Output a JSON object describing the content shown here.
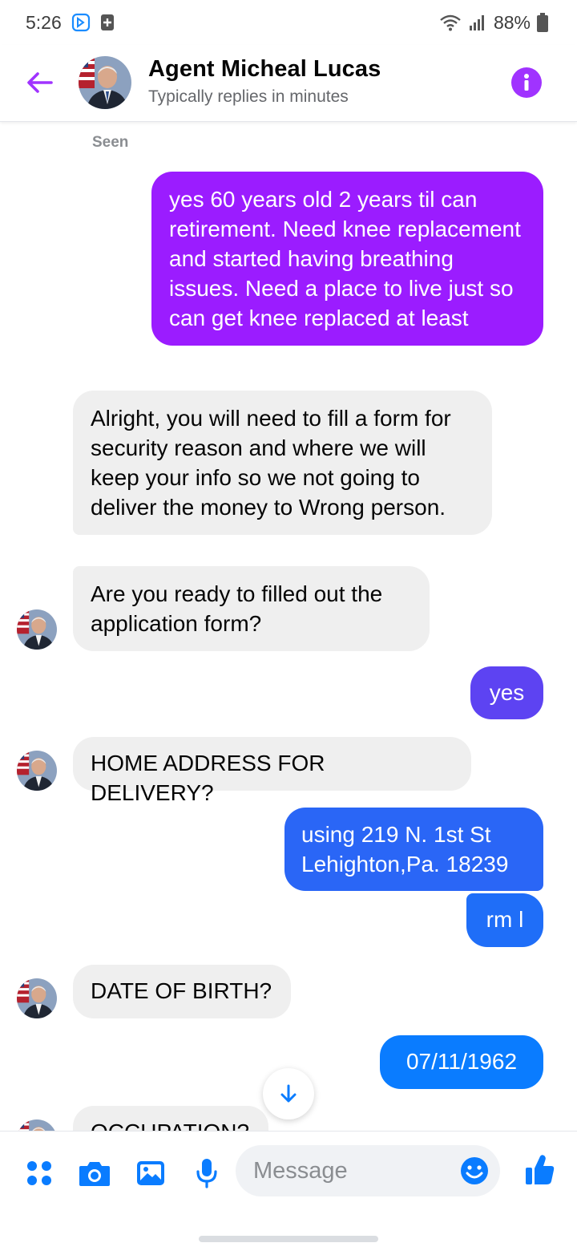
{
  "status_bar": {
    "time": "5:26",
    "battery": "88%"
  },
  "header": {
    "name": "Agent Micheal Lucas",
    "subtitle": "Typically replies in minutes"
  },
  "chat": {
    "seen_label": "Seen",
    "messages": [
      {
        "dir": "out",
        "text": "yes 60 years old 2 years til can retirement. Need knee replacement and started having breathing issues. Need a place to live just so can get knee replaced at least"
      },
      {
        "dir": "in",
        "text": "Alright, you will need to fill a form for security reason and where we will keep your info so we not going to deliver the money to Wrong person."
      },
      {
        "dir": "in",
        "text": "Are you ready to filled out the application form?"
      },
      {
        "dir": "out",
        "text": "yes"
      },
      {
        "dir": "in",
        "text": "HOME ADDRESS FOR DELIVERY?"
      },
      {
        "dir": "out",
        "text": "using 219 N. 1st St Lehighton,Pa. 18239"
      },
      {
        "dir": "out",
        "text": "rm l"
      },
      {
        "dir": "in",
        "text": "DATE OF BIRTH?"
      },
      {
        "dir": "out",
        "text": "07/11/1962"
      },
      {
        "dir": "in",
        "text": "OCCUPATION?"
      }
    ]
  },
  "composer": {
    "placeholder": "Message"
  },
  "colors": {
    "accent": "#a033ff",
    "messenger_blue": "#0a7cff",
    "purple_bubble": "#9b1cff",
    "incoming_bubble": "#efefef"
  },
  "icons": [
    "back-arrow-icon",
    "info-icon",
    "apps-icon",
    "camera-icon",
    "gallery-icon",
    "microphone-icon",
    "emoji-icon",
    "thumbs-up-icon",
    "scroll-down-arrow-icon"
  ]
}
